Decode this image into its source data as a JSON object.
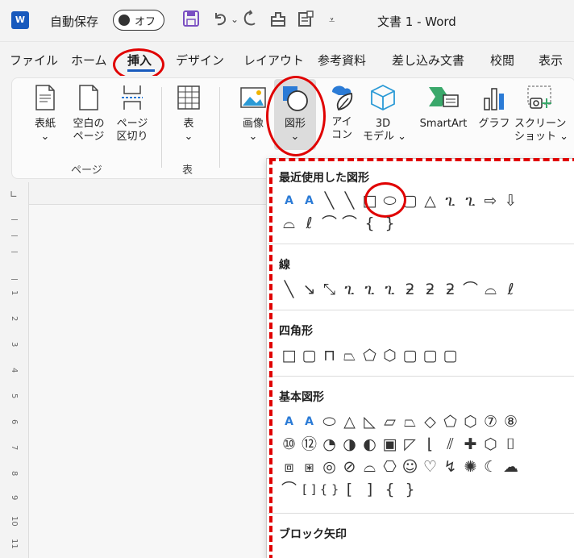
{
  "titlebar": {
    "app_logo": "W",
    "autosave_label": "自動保存",
    "autosave_state": "オフ",
    "doc_title": "文書 1  -  Word",
    "icons": [
      "save-icon",
      "undo-icon",
      "redo-icon",
      "print-preview-icon",
      "document-icon",
      "customize-icon"
    ]
  },
  "tabs": [
    "ファイル",
    "ホーム",
    "挿入",
    "デザイン",
    "レイアウト",
    "参考資料",
    "差し込み文書",
    "校閲",
    "表示"
  ],
  "active_tab": "挿入",
  "ribbon": {
    "cover": "表紙",
    "blank_page_1": "空白の",
    "blank_page_2": "ページ",
    "page_break_1": "ページ",
    "page_break_2": "区切り",
    "pages_group": "ページ",
    "table": "表",
    "table_group": "表",
    "picture": "画像",
    "shapes": "図形",
    "icons_1": "アイ",
    "icons_2": "コン",
    "model3d_1": "3D",
    "model3d_2": "モデル ⌄",
    "smartart": "SmartArt",
    "chart": "グラフ",
    "screenshot_1": "スクリーン",
    "screenshot_2": "ショット ⌄",
    "dropdown_marker": "⌄"
  },
  "ruler_numbers": [
    "1",
    "2",
    "3",
    "4",
    "5",
    "6",
    "7",
    "8",
    "9",
    "10",
    "11"
  ],
  "shapes_menu": {
    "recent_title": "最近使用した図形",
    "recent_row1": [
      "A",
      "A",
      "╲",
      "╲",
      "□",
      "⬭",
      "▢",
      "△",
      "ጊ",
      "ጊ",
      "⇨",
      "⇩"
    ],
    "recent_row2": [
      "⌓",
      "ℓ",
      "⌒",
      "⌒",
      "{",
      "}"
    ],
    "lines_title": "線",
    "lines_row": [
      "╲",
      "↘",
      "⤡",
      "ጊ",
      "ጊ",
      "ጊ",
      "ƻ",
      "ƻ",
      "ƻ",
      "⌒",
      "⌓",
      "ℓ"
    ],
    "rect_title": "四角形",
    "rect_row": [
      "□",
      "▢",
      "⊓",
      "⏢",
      "⬠",
      "⬡",
      "▢",
      "▢",
      "▢"
    ],
    "basic_title": "基本図形",
    "basic_row1": [
      "A",
      "A",
      "⬭",
      "△",
      "◺",
      "▱",
      "⏢",
      "◇",
      "⬠",
      "⬡",
      "⑦",
      "⑧"
    ],
    "basic_row2": [
      "⑩",
      "⑫",
      "◔",
      "◑",
      "◐",
      "▣",
      "◸",
      "⌊",
      "⫽",
      "✚",
      "⬡",
      "⌷"
    ],
    "basic_row3": [
      "⧈",
      "⧆",
      "◎",
      "⊘",
      "⌓",
      "⎔",
      "☺",
      "♡",
      "↯",
      "✺",
      "☾",
      "☁"
    ],
    "basic_row4": [
      "⌒",
      "[ ]",
      "{ }",
      "[",
      "]",
      "{",
      "}"
    ],
    "block_arrows_title": "ブロック矢印"
  }
}
